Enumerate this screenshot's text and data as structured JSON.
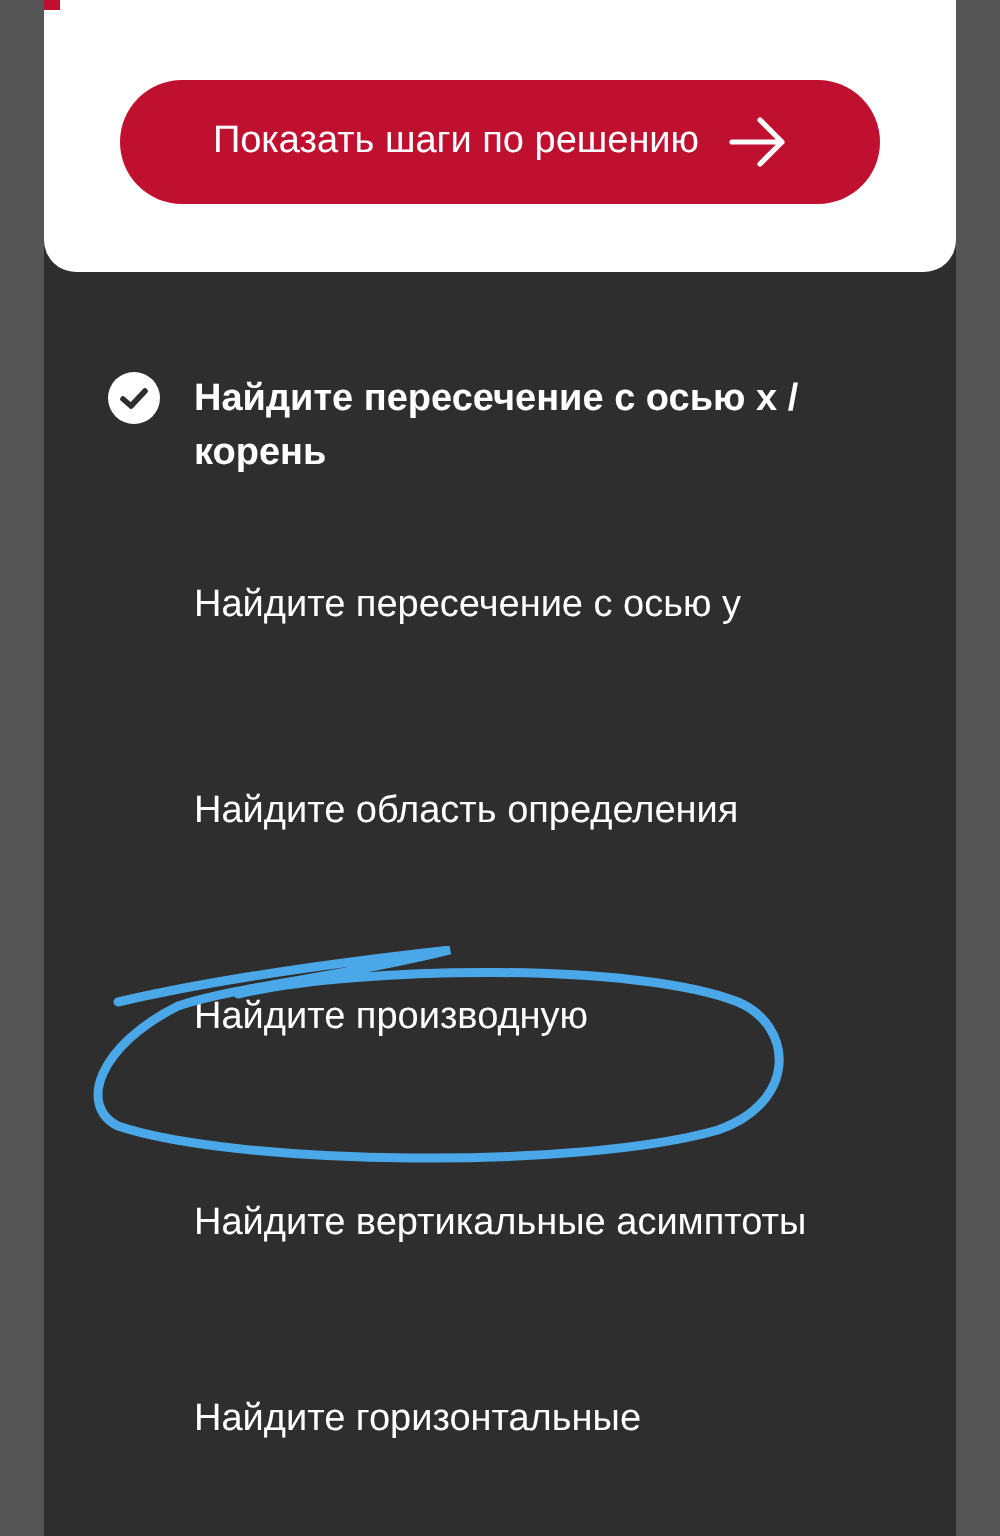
{
  "card": {
    "button": {
      "label": "Показать шаги по решению"
    }
  },
  "steps": [
    {
      "label": "Найдите пересечение с осью x / корень",
      "done": true,
      "circled": false
    },
    {
      "label": "Найдите пересечение с осью y",
      "done": false,
      "circled": false
    },
    {
      "label": "Найдите область определения",
      "done": false,
      "circled": false
    },
    {
      "label": "Найдите производную",
      "done": false,
      "circled": true
    },
    {
      "label": "Найдите вертикальные асимптоты",
      "done": false,
      "circled": false
    },
    {
      "label": "Найдите горизонтальные",
      "done": false,
      "circled": false
    }
  ]
}
